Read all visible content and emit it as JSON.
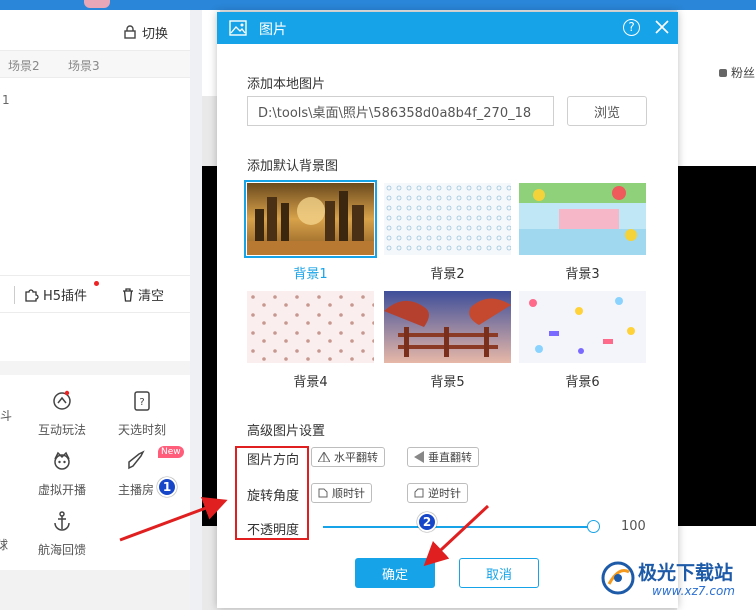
{
  "background": {
    "switch_label": "切换",
    "scene_tabs": [
      "场景2",
      "场景3"
    ],
    "scene_number": "1",
    "h5_plugin_label": "H5插件",
    "clear_label": "清空",
    "features": [
      {
        "label": "互动玩法",
        "icon": "gamepad-icon"
      },
      {
        "label": "天选时刻",
        "icon": "lottery-icon"
      },
      {
        "label": "虚拟开播",
        "icon": "virtual-avatar-icon"
      },
      {
        "label": "主播房",
        "icon": "rocket-icon"
      },
      {
        "label": "航海回馈",
        "icon": "anchor-icon"
      }
    ],
    "partial_left_labels": [
      "斗",
      "球"
    ],
    "new_badge": "New",
    "fans_label": "粉丝"
  },
  "dialog": {
    "title": "图片",
    "help_label": "?",
    "local_image": {
      "section_title": "添加本地图片",
      "path_value": "D:\\tools\\桌面\\照片\\586358d0a8b4f_270_18",
      "browse_label": "浏览"
    },
    "default_bg": {
      "section_title": "添加默认背景图",
      "items": [
        {
          "label": "背景1",
          "selected": true
        },
        {
          "label": "背景2",
          "selected": false
        },
        {
          "label": "背景3",
          "selected": false
        },
        {
          "label": "背景4",
          "selected": false
        },
        {
          "label": "背景5",
          "selected": false
        },
        {
          "label": "背景6",
          "selected": false
        }
      ]
    },
    "advanced": {
      "section_title": "高级图片设置",
      "direction_label": "图片方向",
      "flip_h_label": "水平翻转",
      "flip_v_label": "垂直翻转",
      "rotate_label": "旋转角度",
      "clockwise_label": "顺时针",
      "counterclockwise_label": "逆时针",
      "opacity_label": "不透明度",
      "opacity_value": "100"
    },
    "ok_label": "确定",
    "cancel_label": "取消"
  },
  "annotations": {
    "badge_1": "1",
    "badge_2": "2",
    "color": "#e02020"
  },
  "watermark": {
    "text": "极光下载站",
    "url": "www.xz7.com"
  },
  "colors": {
    "accent": "#17a3e8",
    "annotation_red": "#e02020",
    "badge_blue": "#1746c8"
  }
}
